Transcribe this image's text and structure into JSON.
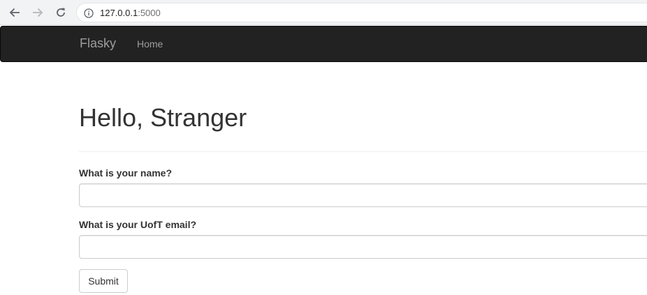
{
  "browser": {
    "url_host": "127.0.0.1",
    "url_port": ":5000"
  },
  "navbar": {
    "brand": "Flasky",
    "links": [
      {
        "label": "Home"
      }
    ]
  },
  "page": {
    "title": "Hello, Stranger"
  },
  "form": {
    "name_label": "What is your name?",
    "name_value": "",
    "email_label": "What is your UofT email?",
    "email_value": "",
    "submit_label": "Submit"
  },
  "colors": {
    "navbar_bg": "#222222",
    "navbar_text": "#9d9d9d",
    "heading_text": "#333333"
  },
  "icons": {
    "back": "back-arrow-icon",
    "forward": "forward-arrow-icon",
    "reload": "reload-icon",
    "info": "info-icon"
  }
}
